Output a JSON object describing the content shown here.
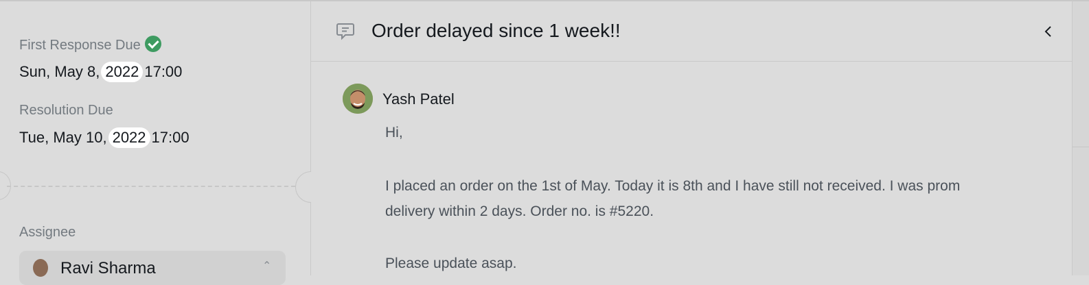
{
  "sla": {
    "first_response_label": "First Response Due",
    "first_response_date_prefix": "Sun, May 8,",
    "first_response_year": "2022",
    "first_response_time": "17:00",
    "resolution_label": "Resolution Due",
    "resolution_date_prefix": "Tue, May 10,",
    "resolution_year": "2022",
    "resolution_time": "17:00"
  },
  "assignee": {
    "label": "Assignee",
    "name": "Ravi Sharma"
  },
  "ticket": {
    "title": "Order delayed since 1 week!!"
  },
  "message": {
    "sender": "Yash Patel",
    "lines": [
      "Hi,",
      "I placed an order on the 1st of May. Today it is 8th and I have still not received. I was prom",
      "delivery within 2 days. Order no. is #5220.",
      "Please update asap."
    ]
  },
  "icons": {
    "message": "message-square-icon",
    "back": "chevron-left-icon",
    "status": "check-circle-icon",
    "select": "chevron-updown-icon"
  },
  "colors": {
    "background": "#dcdcdc",
    "success": "#3e9b61",
    "muted_text": "#737a80",
    "body_text": "#4a5159"
  }
}
